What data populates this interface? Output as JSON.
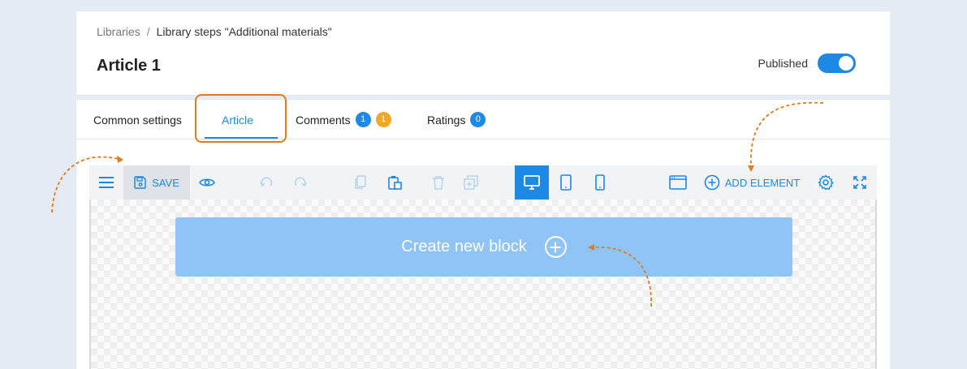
{
  "breadcrumb": {
    "root": "Libraries",
    "separator": "/",
    "current": "Library steps \"Additional materials\""
  },
  "page": {
    "title": "Article 1"
  },
  "status": {
    "label": "Published",
    "enabled": true,
    "toggle_color": "#1e88e5"
  },
  "tabs": [
    {
      "label": "Common settings"
    },
    {
      "label": "Article",
      "active": true
    },
    {
      "label": "Comments",
      "badges": [
        "1",
        "1"
      ]
    },
    {
      "label": "Ratings",
      "badges": [
        "0"
      ]
    }
  ],
  "toolbar": {
    "menu_icon": "hamburger-icon",
    "save_label": "SAVE",
    "add_element_label": "ADD ELEMENT",
    "active_device": "desktop"
  },
  "canvas": {
    "create_block_label": "Create new block"
  },
  "colors": {
    "accent": "#1e88e5",
    "highlight": "#e07b1f",
    "badge_orange": "#f5a623"
  }
}
